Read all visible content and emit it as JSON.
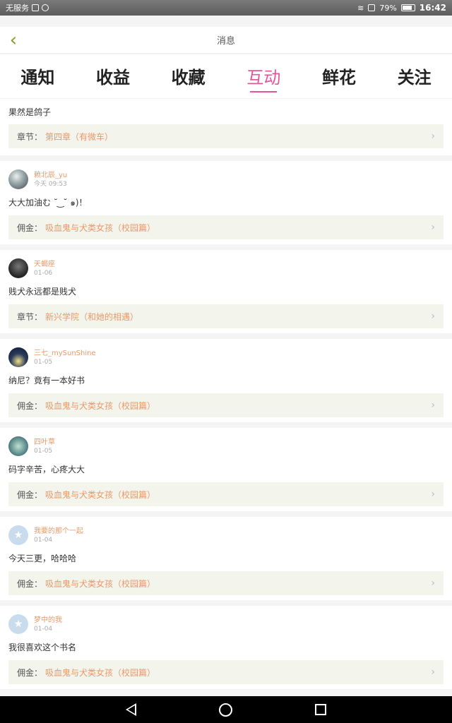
{
  "status_bar": {
    "carrier": "无服务",
    "battery": "79%",
    "time": "16:42"
  },
  "header": {
    "title": "消息"
  },
  "tabs": [
    {
      "label": "通知",
      "active": false
    },
    {
      "label": "收益",
      "active": false
    },
    {
      "label": "收藏",
      "active": false
    },
    {
      "label": "互动",
      "active": true
    },
    {
      "label": "鲜花",
      "active": false
    },
    {
      "label": "关注",
      "active": false
    }
  ],
  "messages": [
    {
      "comment": "果然是鸽子",
      "ref_prefix": "章节",
      "ref_title": "第四章（有微车）"
    },
    {
      "user": "赖北辰_yu",
      "time": "今天 09:53",
      "comment": "大大加油む ˘ ͜ ˘ ๑)！",
      "ref_prefix": "佣金",
      "ref_title": "吸血鬼与犬类女孩（校园篇）"
    },
    {
      "user": "天蝎座",
      "time": "01-06",
      "comment": "贱犬永远都是贱犬",
      "ref_prefix": "章节",
      "ref_title": "新兴学院（和她的相遇）"
    },
    {
      "user": "三七_mySunShine",
      "time": "01-05",
      "comment": "纳尼？竟有一本好书",
      "ref_prefix": "佣金",
      "ref_title": "吸血鬼与犬类女孩（校园篇）"
    },
    {
      "user": "四叶草",
      "time": "01-05",
      "comment": "码字辛苦，心疼大大",
      "ref_prefix": "佣金",
      "ref_title": "吸血鬼与犬类女孩（校园篇）"
    },
    {
      "user": "我要的那个一起",
      "time": "01-04",
      "comment": "今天三更，哈哈哈",
      "ref_prefix": "佣金",
      "ref_title": "吸血鬼与犬类女孩（校园篇）"
    },
    {
      "user": "梦中的我",
      "time": "01-04",
      "comment": "我很喜欢这个书名",
      "ref_prefix": "佣金",
      "ref_title": "吸血鬼与犬类女孩（校园篇）"
    }
  ],
  "colors": {
    "accent": "#e0589a",
    "name_color": "#e79a6a",
    "back_color": "#8a9a2a",
    "ref_bg": "#f3f4ec"
  },
  "icons": {
    "back": "chevron-left-icon",
    "ref_arrow": "chevron-right-icon"
  }
}
